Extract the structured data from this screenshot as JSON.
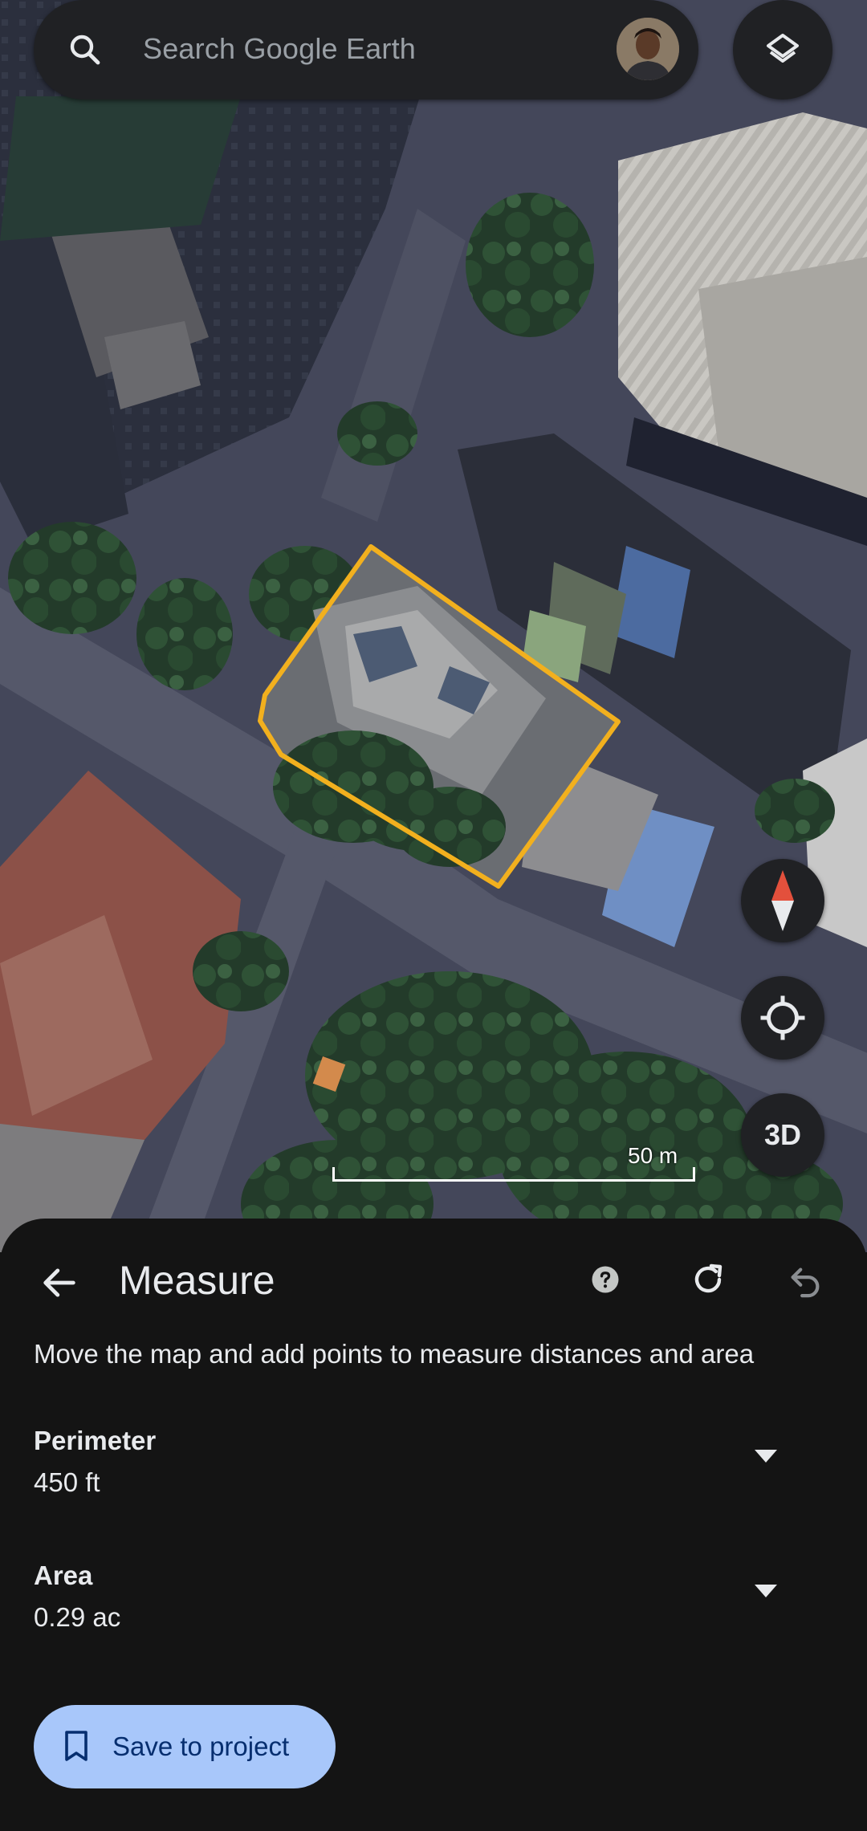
{
  "search": {
    "placeholder": "Search Google Earth",
    "icon": "search-icon",
    "avatar": "account-avatar"
  },
  "map": {
    "layers_icon": "layers-icon",
    "compass_icon": "compass-icon",
    "locate_icon": "my-location-icon",
    "three_d_label": "3D",
    "scale_label": "50 m",
    "measure_outline_color": "#f2b01e"
  },
  "sheet": {
    "title": "Measure",
    "back_icon": "arrow-back-icon",
    "help_icon": "help-icon",
    "reset_icon": "refresh-icon",
    "undo_icon": "undo-icon",
    "instruction": "Move the map and add points to measure distances and area",
    "metrics": [
      {
        "label": "Perimeter",
        "value": "450 ft"
      },
      {
        "label": "Area",
        "value": "0.29 ac"
      }
    ],
    "save_label": "Save to project",
    "save_icon": "bookmark-icon"
  }
}
